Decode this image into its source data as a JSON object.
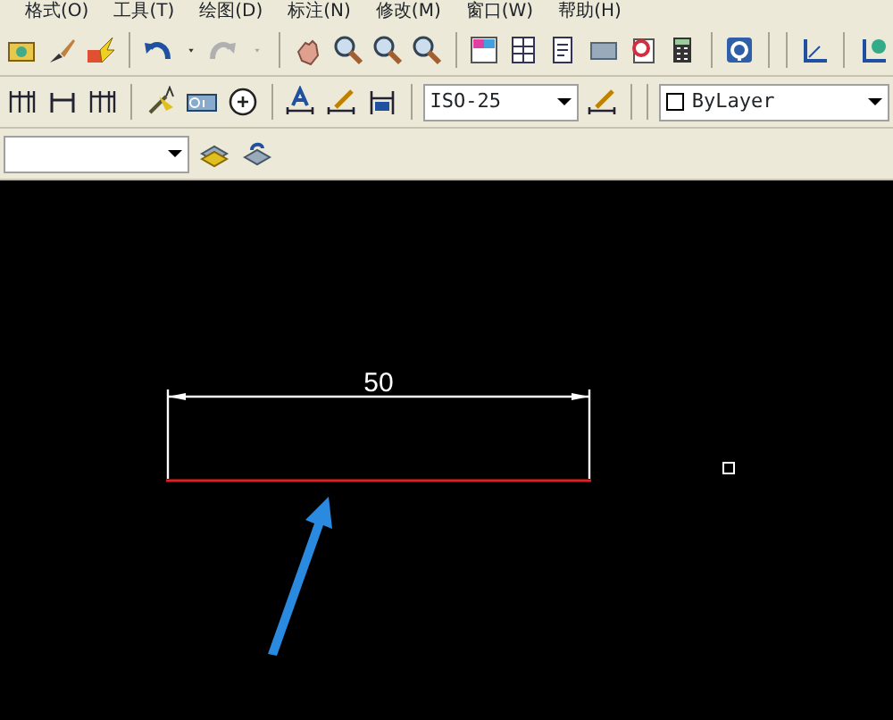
{
  "menu_bar": [
    {
      "label": "格式(O)"
    },
    {
      "label": "工具(T)"
    },
    {
      "label": "绘图(D)"
    },
    {
      "label": "标注(N)"
    },
    {
      "label": "修改(M)"
    },
    {
      "label": "窗口(W)"
    },
    {
      "label": "帮助(H)"
    }
  ],
  "standard_toolbar": {
    "undo": {
      "disabled": false
    },
    "redo": {
      "disabled": true
    }
  },
  "dimension_toolbar": {
    "dim_style": {
      "value": "ISO-25"
    }
  },
  "properties_toolbar": {
    "color": {
      "value": "ByLayer"
    }
  },
  "drawing": {
    "dimension_text": "50"
  }
}
